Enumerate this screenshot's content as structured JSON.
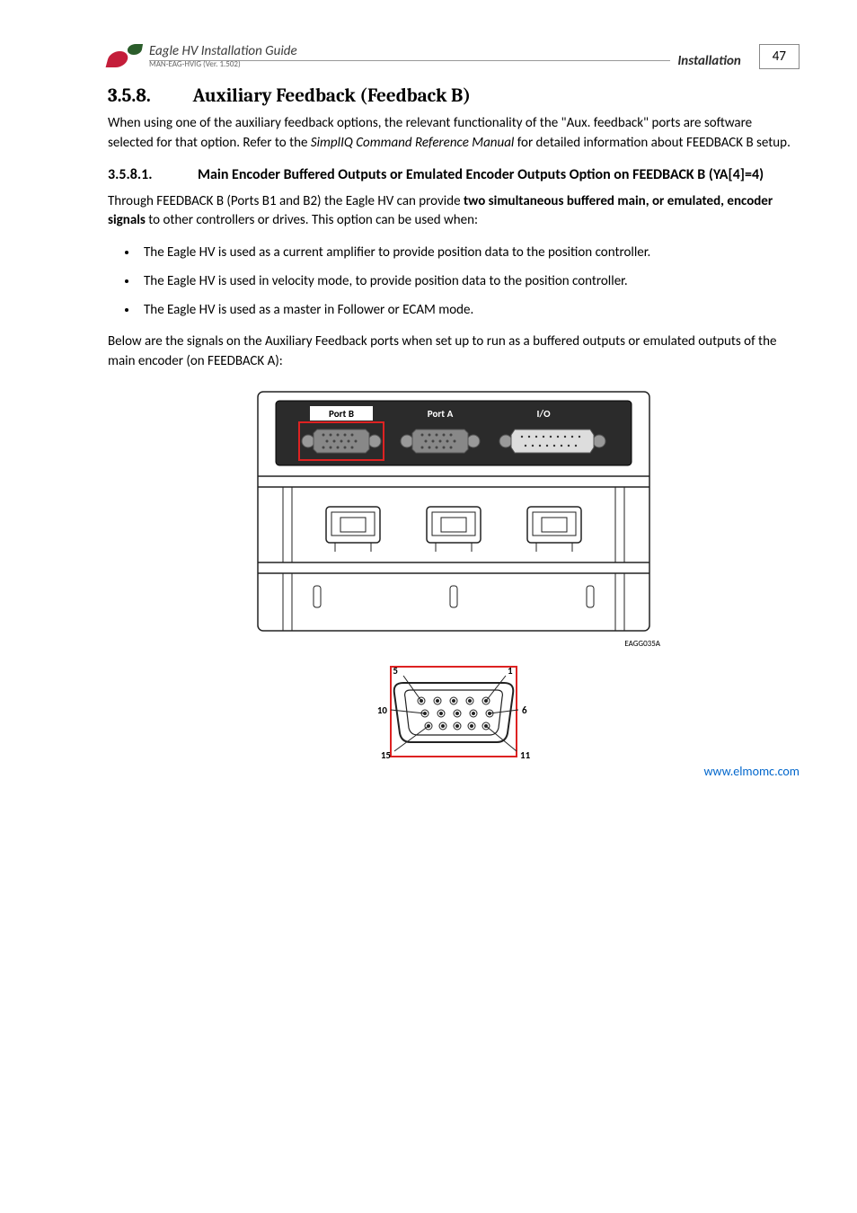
{
  "header": {
    "doc_title": "Eagle HV Installation Guide",
    "doc_code": "MAN-EAG-HVIG (Ver. 1.502)",
    "section_label": "Installation",
    "page_number": "47"
  },
  "section": {
    "number": "3.5.8.",
    "title": "Auxiliary Feedback (Feedback B)"
  },
  "intro_paragraph_1": "When using one of the auxiliary feedback options, the relevant functionality of the \"Aux. feedback\" ports are software selected for that option. Refer to the ",
  "intro_italic": "SimplIQ Command Reference Manual",
  "intro_paragraph_2": " for detailed information about FEEDBACK B setup.",
  "subsection": {
    "number": "3.5.8.1.",
    "title": "Main Encoder Buffered Outputs or Emulated Encoder Outputs Option on FEEDBACK B (YA[4]=4)"
  },
  "para2_a": "Through FEEDBACK B (Ports B1 and B2) the Eagle HV can provide ",
  "para2_bold": "two simultaneous buffered main, or emulated, encoder signals",
  "para2_b": " to other controllers or drives. This option can be used when:",
  "bullets": [
    "The Eagle HV is used as a current amplifier to provide position data to the position controller.",
    "The Eagle HV is used in velocity mode, to provide position data to the position controller.",
    "The Eagle HV is used as a master in Follower or ECAM mode."
  ],
  "para3": "Below are the signals on the Auxiliary Feedback ports when set up to run as a buffered outputs or emulated outputs of the main encoder (on FEEDBACK A):",
  "figure": {
    "port_labels": [
      "Port B",
      "Port A",
      "I/O"
    ],
    "code": "EAGG035A",
    "pin_labels": {
      "top_right": "1",
      "top_left": "5",
      "mid_right": "6",
      "mid_left": "10",
      "bot_right": "11",
      "bot_left": "15"
    }
  },
  "footer_url": "www.elmomc.com"
}
